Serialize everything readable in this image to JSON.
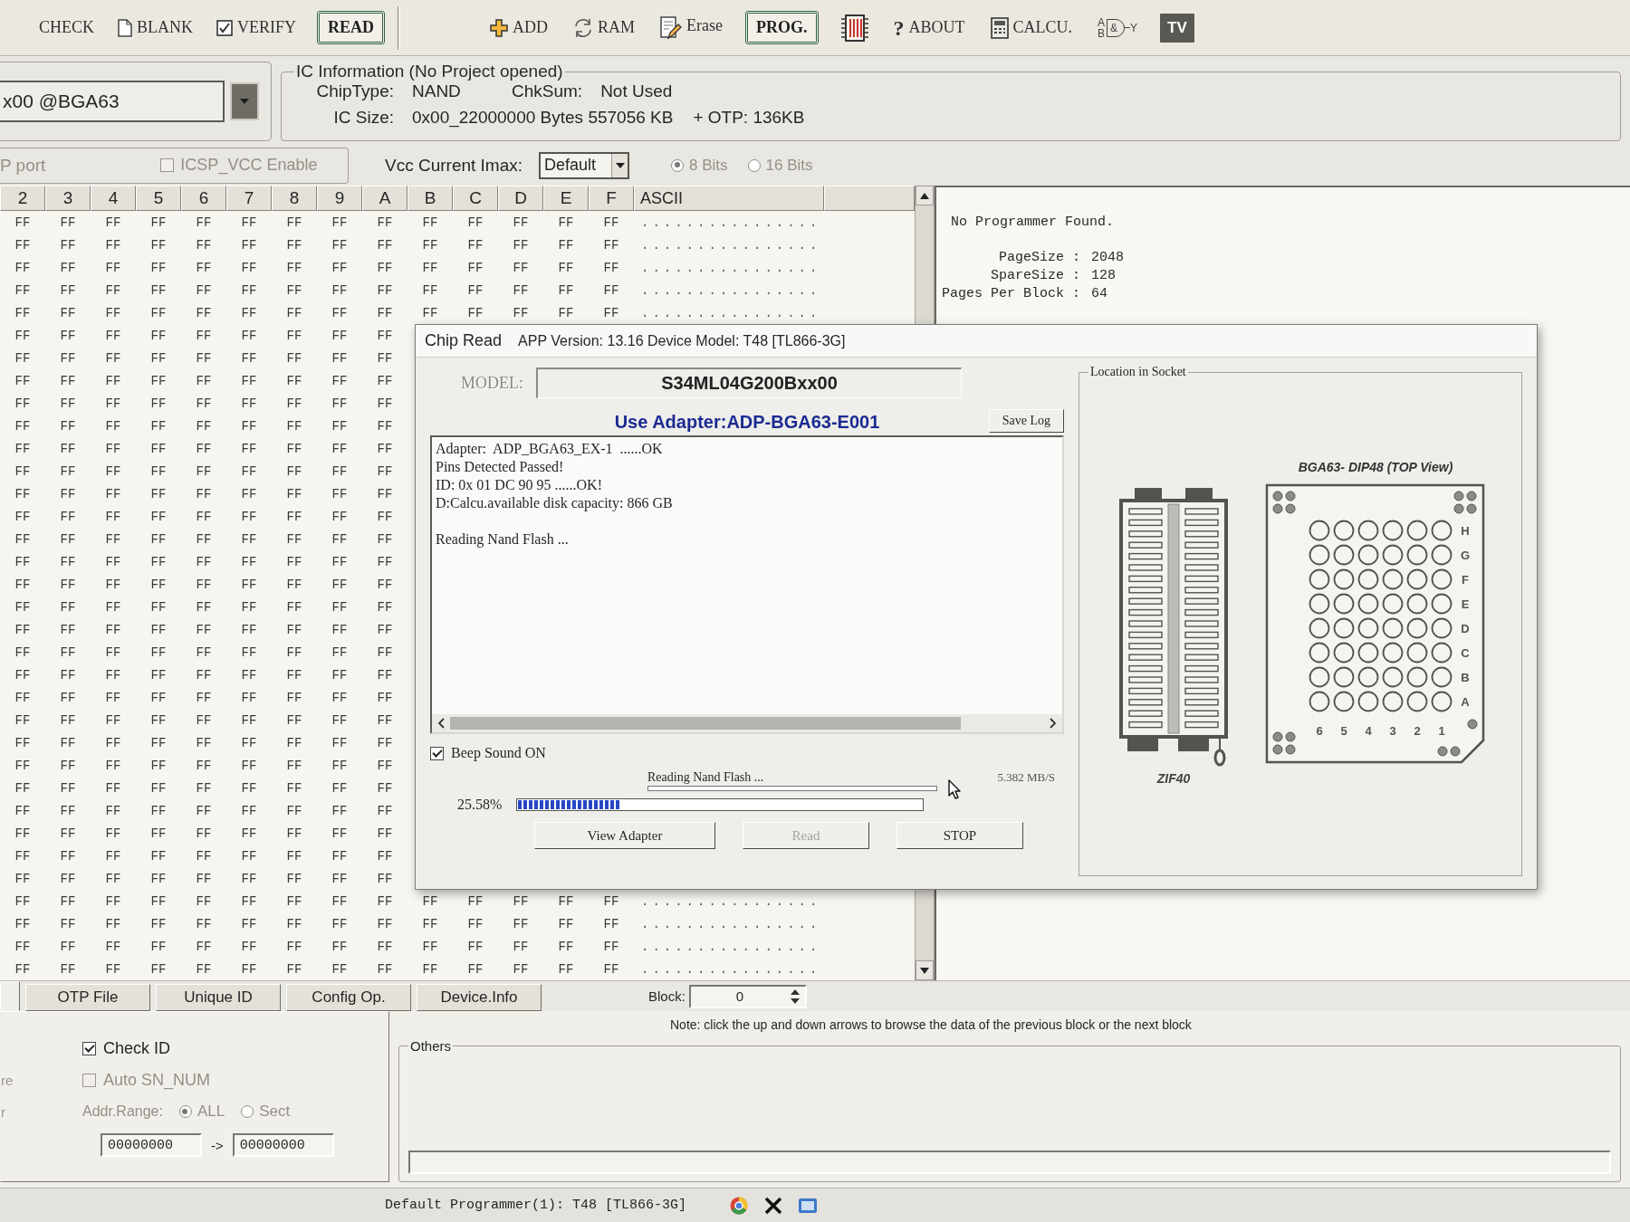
{
  "toolbar": {
    "groups": [
      [
        {
          "kind": "check",
          "label": "CHECK"
        },
        {
          "kind": "blank",
          "label": "BLANK"
        },
        {
          "kind": "verify",
          "label": "VERIFY"
        },
        {
          "kind": "read",
          "label": "READ"
        }
      ],
      [
        {
          "kind": "add",
          "label": "ADD"
        },
        {
          "kind": "ram",
          "label": "RAM"
        },
        {
          "kind": "erase",
          "label": "Erase"
        },
        {
          "kind": "program",
          "label": "PROG."
        },
        {
          "kind": "chip"
        },
        {
          "kind": "about",
          "glyph": "?",
          "label": "ABOUT"
        },
        {
          "kind": "calculator",
          "label": "CALCU."
        },
        {
          "kind": "gate",
          "inputs": [
            "A",
            "B"
          ],
          "symbol": "&",
          "output": "Y"
        },
        {
          "kind": "tv",
          "label": "TV"
        }
      ]
    ]
  },
  "device": {
    "value": "x00 @BGA63"
  },
  "ic_info": {
    "title": "IC Information (No Project opened)",
    "chip_type_label": "ChipType:",
    "chip_type": "NAND",
    "checksum_label": "ChkSum:",
    "checksum": "Not Used",
    "size_label": "IC Size:",
    "size": "0x00_22000000 Bytes 557056 KB",
    "otp": "+ OTP: 136KB"
  },
  "port": {
    "label": "P port",
    "disabled": true
  },
  "icsp_vcc": {
    "label": "ICSP_VCC Enable",
    "checked": false,
    "disabled": true
  },
  "vcc_current": {
    "label": "Vcc Current Imax:",
    "value": "Default"
  },
  "bus_width": {
    "disabled": true,
    "options": [
      {
        "label": "8 Bits",
        "selected": true
      },
      {
        "label": "16 Bits",
        "selected": false
      }
    ]
  },
  "hex_view": {
    "columns": [
      "2",
      "3",
      "4",
      "5",
      "6",
      "7",
      "8",
      "9",
      "A",
      "B",
      "C",
      "D",
      "E",
      "F"
    ],
    "ascii_header": "ASCII",
    "rows": [
      {
        "cells": [
          "FF",
          "FF",
          "FF",
          "FF",
          "FF",
          "FF",
          "FF",
          "FF",
          "FF",
          "FF",
          "FF",
          "FF",
          "FF",
          "FF"
        ],
        "ascii": "................"
      },
      {
        "cells": [
          "FF",
          "FF",
          "FF",
          "FF",
          "FF",
          "FF",
          "FF",
          "FF",
          "FF",
          "FF",
          "FF",
          "FF",
          "FF",
          "FF"
        ],
        "ascii": "................"
      },
      {
        "cells": [
          "FF",
          "FF",
          "FF",
          "FF",
          "FF",
          "FF",
          "FF",
          "FF",
          "FF",
          "FF",
          "FF",
          "FF",
          "FF",
          "FF"
        ],
        "ascii": "................"
      },
      {
        "cells": [
          "FF",
          "FF",
          "FF",
          "FF",
          "FF",
          "FF",
          "FF",
          "FF",
          "FF",
          "FF",
          "FF",
          "FF",
          "FF",
          "FF"
        ],
        "ascii": "................"
      },
      {
        "cells": [
          "FF",
          "FF",
          "FF",
          "FF",
          "FF",
          "FF",
          "FF",
          "FF",
          "FF",
          "FF",
          "FF",
          "FF",
          "FF",
          "FF"
        ],
        "ascii": "................"
      },
      {
        "cells": [
          "FF",
          "FF",
          "FF",
          "FF",
          "FF",
          "FF",
          "FF",
          "FF",
          "FF"
        ]
      },
      {
        "cells": [
          "FF",
          "FF",
          "FF",
          "FF",
          "FF",
          "FF",
          "FF",
          "FF",
          "FF"
        ]
      },
      {
        "cells": [
          "FF",
          "FF",
          "FF",
          "FF",
          "FF",
          "FF",
          "FF",
          "FF",
          "FF"
        ]
      },
      {
        "cells": [
          "FF",
          "FF",
          "FF",
          "FF",
          "FF",
          "FF",
          "FF",
          "FF",
          "FF"
        ]
      },
      {
        "cells": [
          "FF",
          "FF",
          "FF",
          "FF",
          "FF",
          "FF",
          "FF",
          "FF",
          "FF"
        ]
      },
      {
        "cells": [
          "FF",
          "FF",
          "FF",
          "FF",
          "FF",
          "FF",
          "FF",
          "FF",
          "FF"
        ]
      },
      {
        "cells": [
          "FF",
          "FF",
          "FF",
          "FF",
          "FF",
          "FF",
          "FF",
          "FF",
          "FF"
        ]
      },
      {
        "cells": [
          "FF",
          "FF",
          "FF",
          "FF",
          "FF",
          "FF",
          "FF",
          "FF",
          "FF"
        ]
      },
      {
        "cells": [
          "FF",
          "FF",
          "FF",
          "FF",
          "FF",
          "FF",
          "FF",
          "FF",
          "FF"
        ]
      },
      {
        "cells": [
          "FF",
          "FF",
          "FF",
          "FF",
          "FF",
          "FF",
          "FF",
          "FF",
          "FF"
        ]
      },
      {
        "cells": [
          "FF",
          "FF",
          "FF",
          "FF",
          "FF",
          "FF",
          "FF",
          "FF",
          "FF"
        ]
      },
      {
        "cells": [
          "FF",
          "FF",
          "FF",
          "FF",
          "FF",
          "FF",
          "FF",
          "FF",
          "FF"
        ]
      },
      {
        "cells": [
          "FF",
          "FF",
          "FF",
          "FF",
          "FF",
          "FF",
          "FF",
          "FF",
          "FF"
        ]
      },
      {
        "cells": [
          "FF",
          "FF",
          "FF",
          "FF",
          "FF",
          "FF",
          "FF",
          "FF",
          "FF"
        ]
      },
      {
        "cells": [
          "FF",
          "FF",
          "FF",
          "FF",
          "FF",
          "FF",
          "FF",
          "FF",
          "FF"
        ]
      },
      {
        "cells": [
          "FF",
          "FF",
          "FF",
          "FF",
          "FF",
          "FF",
          "FF",
          "FF",
          "FF"
        ]
      },
      {
        "cells": [
          "FF",
          "FF",
          "FF",
          "FF",
          "FF",
          "FF",
          "FF",
          "FF",
          "FF"
        ]
      },
      {
        "cells": [
          "FF",
          "FF",
          "FF",
          "FF",
          "FF",
          "FF",
          "FF",
          "FF",
          "FF"
        ]
      },
      {
        "cells": [
          "FF",
          "FF",
          "FF",
          "FF",
          "FF",
          "FF",
          "FF",
          "FF",
          "FF"
        ]
      },
      {
        "cells": [
          "FF",
          "FF",
          "FF",
          "FF",
          "FF",
          "FF",
          "FF",
          "FF",
          "FF"
        ]
      },
      {
        "cells": [
          "FF",
          "FF",
          "FF",
          "FF",
          "FF",
          "FF",
          "FF",
          "FF",
          "FF"
        ]
      },
      {
        "cells": [
          "FF",
          "FF",
          "FF",
          "FF",
          "FF",
          "FF",
          "FF",
          "FF",
          "FF"
        ]
      },
      {
        "cells": [
          "FF",
          "FF",
          "FF",
          "FF",
          "FF",
          "FF",
          "FF",
          "FF",
          "FF"
        ]
      },
      {
        "cells": [
          "FF",
          "FF",
          "FF",
          "FF",
          "FF",
          "FF",
          "FF",
          "FF",
          "FF"
        ]
      },
      {
        "cells": [
          "FF",
          "FF",
          "FF",
          "FF",
          "FF",
          "FF",
          "FF",
          "FF",
          "FF"
        ]
      },
      {
        "cells": [
          "FF",
          "FF",
          "FF",
          "FF",
          "FF",
          "FF",
          "FF",
          "FF",
          "FF",
          "FF",
          "FF",
          "FF",
          "FF",
          "FF"
        ],
        "ascii": "................"
      },
      {
        "cells": [
          "FF",
          "FF",
          "FF",
          "FF",
          "FF",
          "FF",
          "FF",
          "FF",
          "FF",
          "FF",
          "FF",
          "FF",
          "FF",
          "FF"
        ],
        "ascii": "................"
      },
      {
        "cells": [
          "FF",
          "FF",
          "FF",
          "FF",
          "FF",
          "FF",
          "FF",
          "FF",
          "FF",
          "FF",
          "FF",
          "FF",
          "FF",
          "FF"
        ],
        "ascii": "................"
      },
      {
        "cells": [
          "FF",
          "FF",
          "FF",
          "FF",
          "FF",
          "FF",
          "FF",
          "FF",
          "FF",
          "FF",
          "FF",
          "FF",
          "FF",
          "FF"
        ],
        "ascii": "................"
      }
    ]
  },
  "info_panel": {
    "message": "No Programmer Found.",
    "params": [
      {
        "label": "PageSize :",
        "value": "2048"
      },
      {
        "label": "SpareSize :",
        "value": "128"
      },
      {
        "label": "Pages Per Block :",
        "value": "64"
      }
    ]
  },
  "chip_read_dialog": {
    "title": "Chip Read",
    "app_version": "APP Version: 13.16 Device Model: T48 [TL866-3G]",
    "model_label": "MODEL:",
    "model": "S34ML04G200Bxx00",
    "adapter": "Use Adapter:ADP-BGA63-E001",
    "save_log": "Save Log",
    "log": [
      [
        "Adapter:  ADP_BGA63_EX-1  ......OK",
        "Pins Detected Passed!",
        "ID: 0x 01 DC 90 95 ......OK!",
        "D:Calcu.available disk capacity: 866 GB"
      ],
      [
        "Reading Nand Flash ..."
      ]
    ],
    "beep": {
      "label": "Beep Sound ON",
      "checked": true
    },
    "status": "Reading Nand Flash ...",
    "speed": "5.382 MB/S",
    "progress": {
      "percent": "25.58%",
      "level": 0.2558
    },
    "buttons": [
      {
        "label": "View Adapter",
        "disabled": false
      },
      {
        "label": "Read",
        "disabled": true
      },
      {
        "label": "STOP",
        "disabled": false
      }
    ],
    "socket": {
      "title": "Location in Socket",
      "zif_label": "ZIF40",
      "bga_title": "BGA63- DIP48 (TOP View)",
      "row_labels": [
        "H",
        "G",
        "F",
        "E",
        "D",
        "C",
        "B",
        "A"
      ],
      "column_labels": [
        "6",
        "5",
        "4",
        "3",
        "2",
        "1"
      ]
    }
  },
  "tabs": [
    {
      "selected": true
    },
    {
      "label": "OTP File",
      "selected": false
    },
    {
      "label": "Unique ID",
      "selected": false
    },
    {
      "label": "Config Op.",
      "selected": false
    },
    {
      "label": "Device.Info",
      "selected": false
    }
  ],
  "block": {
    "label": "Block:",
    "value": "0"
  },
  "note": "Note: click the up and down arrows to browse the data of the previous block or the next block",
  "operation_options": {
    "edge_labels": [
      "re",
      "r"
    ],
    "check_id": {
      "label": "Check ID",
      "checked": true,
      "disabled": false
    },
    "auto_sn": {
      "label": "Auto SN_NUM",
      "checked": false,
      "disabled": true
    },
    "addr_range": {
      "label": "Addr.Range:",
      "disabled": true,
      "options": [
        {
          "label": "ALL",
          "selected": true
        },
        {
          "label": "Sect",
          "selected": false
        }
      ],
      "start": "00000000",
      "separator": "->",
      "end": "00000000"
    }
  },
  "others": {
    "title": "Others"
  },
  "status_bar": {
    "text": "Default Programmer(1): T48 [TL866-3G]",
    "icons": [
      {
        "kind": "round"
      },
      {
        "kind": "cross"
      },
      {
        "kind": "window"
      }
    ]
  }
}
